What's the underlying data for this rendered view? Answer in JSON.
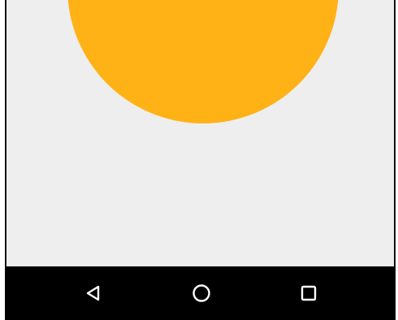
{
  "screen": {
    "background_color": "#eeeeee",
    "circle_color": "#ffb216",
    "circle_text": ""
  },
  "navigation_bar": {
    "background_color": "#000000",
    "buttons": [
      {
        "name": "back",
        "icon": "back-triangle-icon"
      },
      {
        "name": "home",
        "icon": "home-circle-icon"
      },
      {
        "name": "recents",
        "icon": "recents-square-icon"
      }
    ]
  }
}
